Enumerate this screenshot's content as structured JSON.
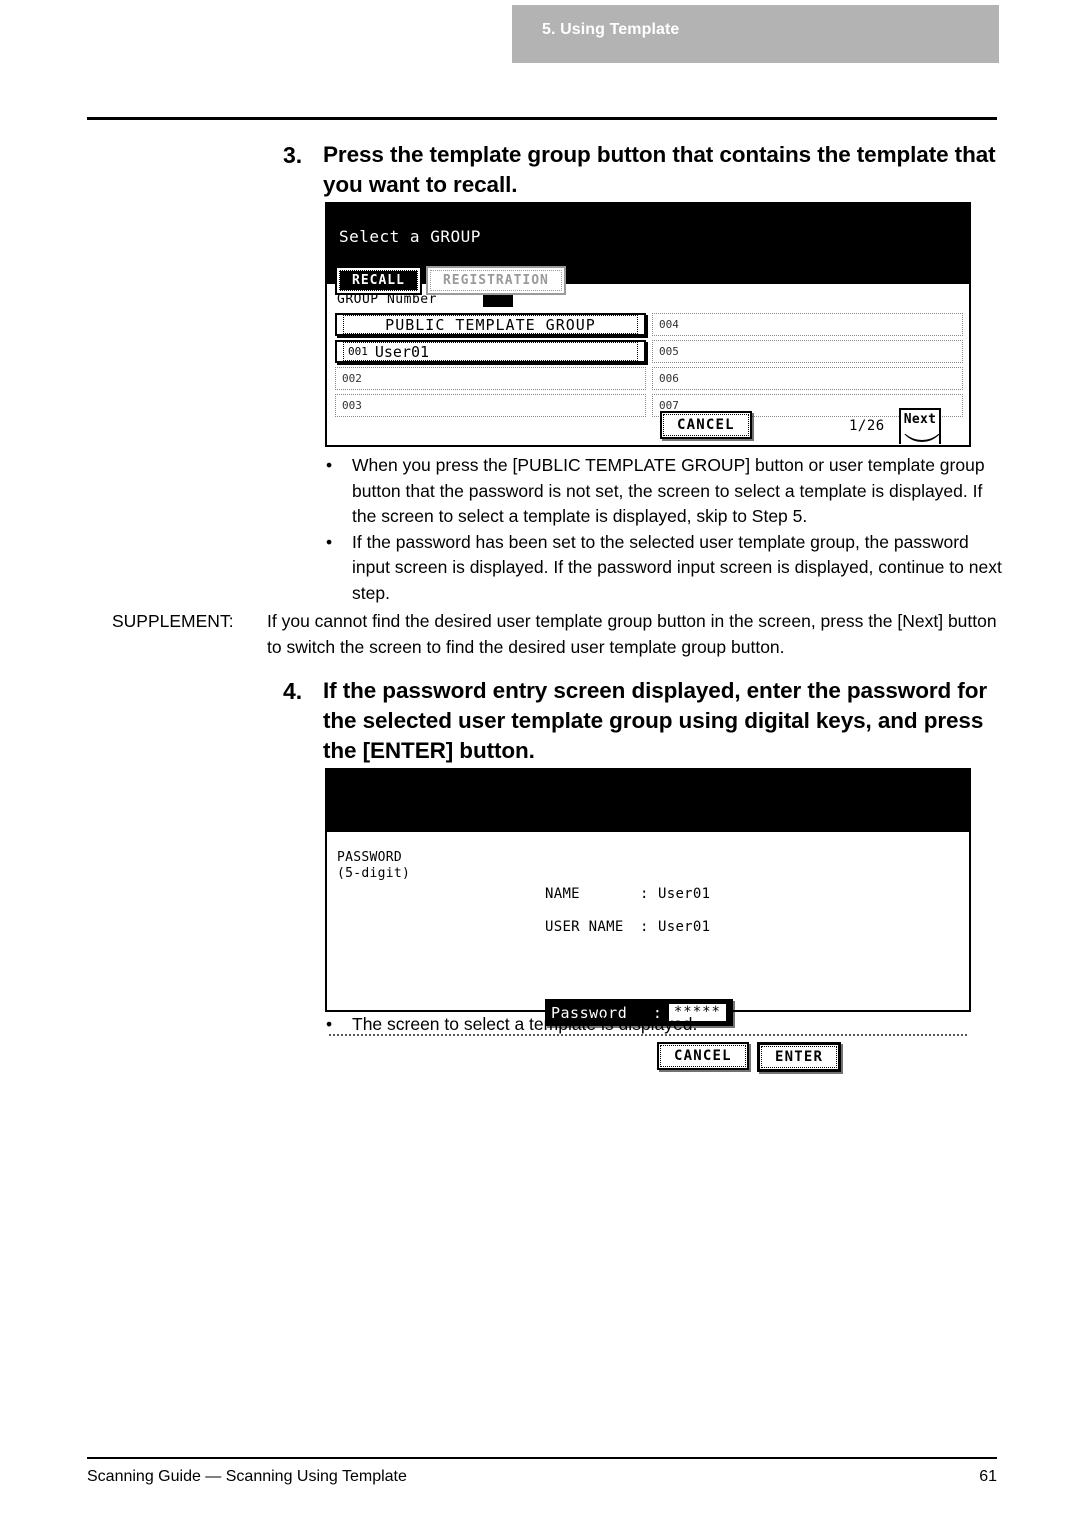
{
  "chapter_header": {
    "label": "5. Using Template"
  },
  "steps": [
    {
      "number": "3.",
      "text": "Press the template group button that contains the template that you want to recall."
    },
    {
      "number": "4.",
      "text": "If the password entry screen displayed, enter the password for the selected user template group using digital keys, and press the [ENTER] button."
    }
  ],
  "bullets_after_step3": [
    "When you press the [PUBLIC TEMPLATE GROUP] button or user template group button that the password is not set, the screen to select a template is displayed.  If the screen to select a template is displayed, skip to Step 5.",
    "If the password has been set to the selected user template group, the password input screen is displayed.  If the password input screen is displayed, continue to next step."
  ],
  "bullets_after_step4": [
    "The screen to select a template is displayed."
  ],
  "bullet_marker": "•",
  "supplement": {
    "label": "SUPPLEMENT:",
    "text": "If you cannot find the desired user template group button in the screen, press the [Next] button to switch the screen to find the desired user template group button."
  },
  "group_panel": {
    "title": "Select a GROUP",
    "tabs": [
      {
        "label": "RECALL",
        "selected": true
      },
      {
        "label": "REGISTRATION",
        "selected": false
      }
    ],
    "group_number_label": "GROUP Number",
    "group_number_value": "",
    "left_column": [
      {
        "num": "",
        "name": "PUBLIC TEMPLATE GROUP",
        "style": "highlight-centered"
      },
      {
        "num": "001",
        "name": "User01",
        "style": "highlight"
      },
      {
        "num": "002",
        "name": "",
        "style": "plain"
      },
      {
        "num": "003",
        "name": "",
        "style": "plain"
      }
    ],
    "right_column": [
      {
        "num": "004",
        "name": "",
        "style": "plain"
      },
      {
        "num": "005",
        "name": "",
        "style": "plain"
      },
      {
        "num": "006",
        "name": "",
        "style": "plain"
      },
      {
        "num": "007",
        "name": "",
        "style": "plain"
      }
    ],
    "cancel_label": "CANCEL",
    "page_indicator": "1/26",
    "next_label": "Next"
  },
  "password_panel": {
    "title": "",
    "password_label_line1": "PASSWORD",
    "password_label_line2": "(5-digit)",
    "fields": [
      {
        "key": "NAME",
        "colon": ":",
        "value": "User01"
      },
      {
        "key": "USER NAME",
        "colon": ":",
        "value": "User01"
      }
    ],
    "input": {
      "label": "Password",
      "colon": ":",
      "value": "*****"
    },
    "cancel_label": "CANCEL",
    "enter_label": "ENTER"
  },
  "footer": {
    "text": "Scanning Guide — Scanning Using Template",
    "page_number": "61"
  }
}
